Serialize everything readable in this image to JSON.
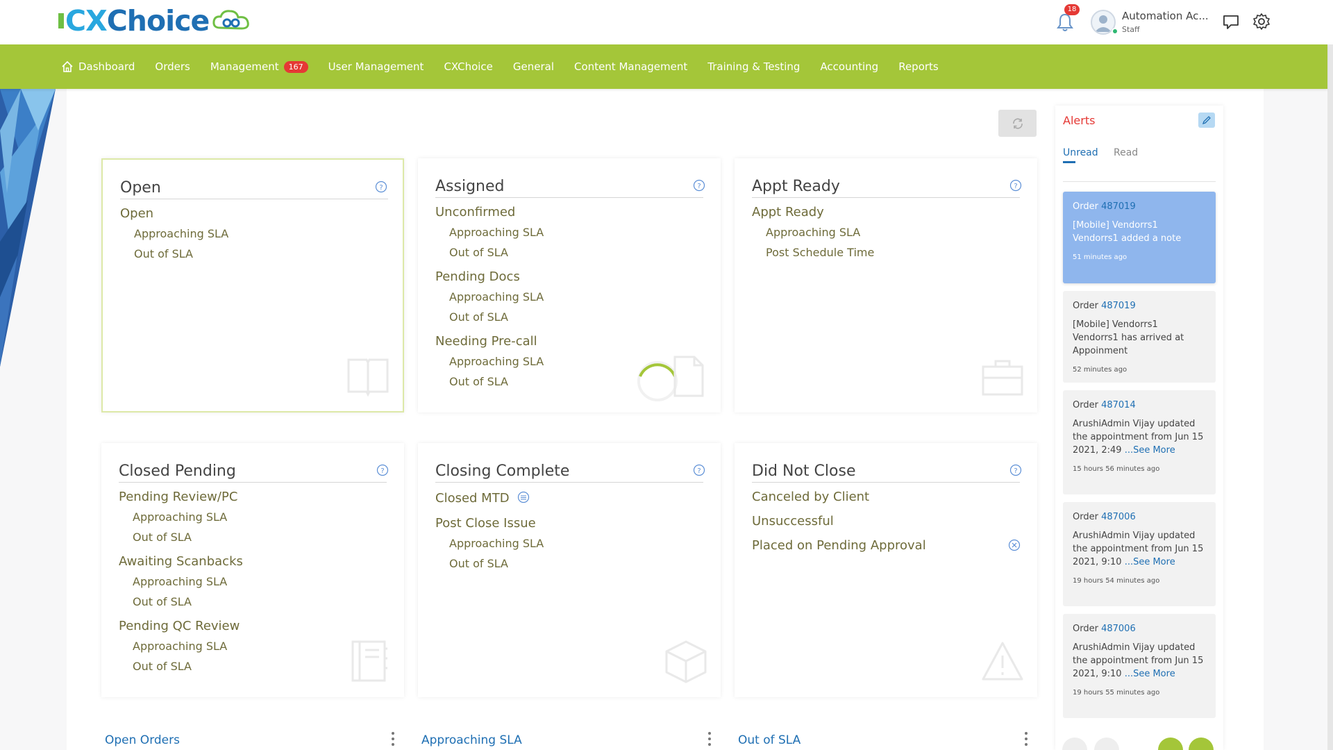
{
  "brand": {
    "logo_cx": "CX",
    "logo_choice": "Choice"
  },
  "header": {
    "notification_count": "18",
    "user_name": "Automation Ac...",
    "user_role": "Staff"
  },
  "nav": {
    "items": [
      {
        "label": "Dashboard",
        "icon": "home-icon"
      },
      {
        "label": "Orders"
      },
      {
        "label": "Management",
        "badge": "167"
      },
      {
        "label": "User Management"
      },
      {
        "label": "CXChoice"
      },
      {
        "label": "General"
      },
      {
        "label": "Content Management"
      },
      {
        "label": "Training & Testing"
      },
      {
        "label": "Accounting"
      },
      {
        "label": "Reports"
      }
    ]
  },
  "cards": {
    "open": {
      "title": "Open",
      "g1": "Open",
      "g1s1": "Approaching SLA",
      "g1s2": "Out of SLA"
    },
    "assigned": {
      "title": "Assigned",
      "g1": "Unconfirmed",
      "g1s1": "Approaching SLA",
      "g1s2": "Out of SLA",
      "g2": "Pending Docs",
      "g2s1": "Approaching SLA",
      "g2s2": "Out of SLA",
      "g3": "Needing Pre-call",
      "g3s1": "Approaching SLA",
      "g3s2": "Out of SLA"
    },
    "appt_ready": {
      "title": "Appt Ready",
      "g1": "Appt Ready",
      "g1s1": "Approaching SLA",
      "g1s2": "Post Schedule Time"
    },
    "closed_pending": {
      "title": "Closed Pending",
      "g1": "Pending Review/PC",
      "g1s1": "Approaching SLA",
      "g1s2": "Out of SLA",
      "g2": "Awaiting Scanbacks",
      "g2s1": "Approaching SLA",
      "g2s2": "Out of SLA",
      "g3": "Pending QC Review",
      "g3s1": "Approaching SLA",
      "g3s2": "Out of SLA"
    },
    "closing_complete": {
      "title": "Closing Complete",
      "g1": "Closed MTD",
      "g2": "Post Close Issue",
      "g2s1": "Approaching SLA",
      "g2s2": "Out of SLA"
    },
    "did_not_close": {
      "title": "Did Not Close",
      "g1": "Canceled by Client",
      "g2": "Unsuccessful",
      "g3": "Placed on Pending Approval"
    }
  },
  "sections": {
    "open_orders": "Open Orders",
    "approaching_sla": "Approaching SLA",
    "out_of_sla": "Out of SLA"
  },
  "alerts": {
    "title": "Alerts",
    "tab_unread": "Unread",
    "tab_read": "Read",
    "order_prefix": "Order",
    "see_more": "...See More",
    "items": [
      {
        "order": "487019",
        "message": "[Mobile] Vendorrs1 Vendorrs1 added a note",
        "time": "51 minutes ago",
        "unread": true
      },
      {
        "order": "487019",
        "message": "[Mobile] Vendorrs1 Vendorrs1 has arrived at Appoinment",
        "time": "52 minutes ago"
      },
      {
        "order": "487014",
        "message": "ArushiAdmin Vijay updated the appointment from Jun 15 2021, 2:49",
        "time": "15 hours 56 minutes ago"
      },
      {
        "order": "487006",
        "message": "ArushiAdmin Vijay updated the appointment from Jun 15 2021, 9:10",
        "time": "19 hours 54 minutes ago"
      },
      {
        "order": "487006",
        "message": "ArushiAdmin Vijay updated the appointment from Jun 15 2021, 9:10",
        "time": "19 hours 55 minutes ago"
      }
    ]
  },
  "colors": {
    "nav_bg": "#a4c639",
    "brand_blue": "#1f6fb3",
    "alert_red": "#e53935",
    "unread_bg": "#8fb6ed"
  }
}
